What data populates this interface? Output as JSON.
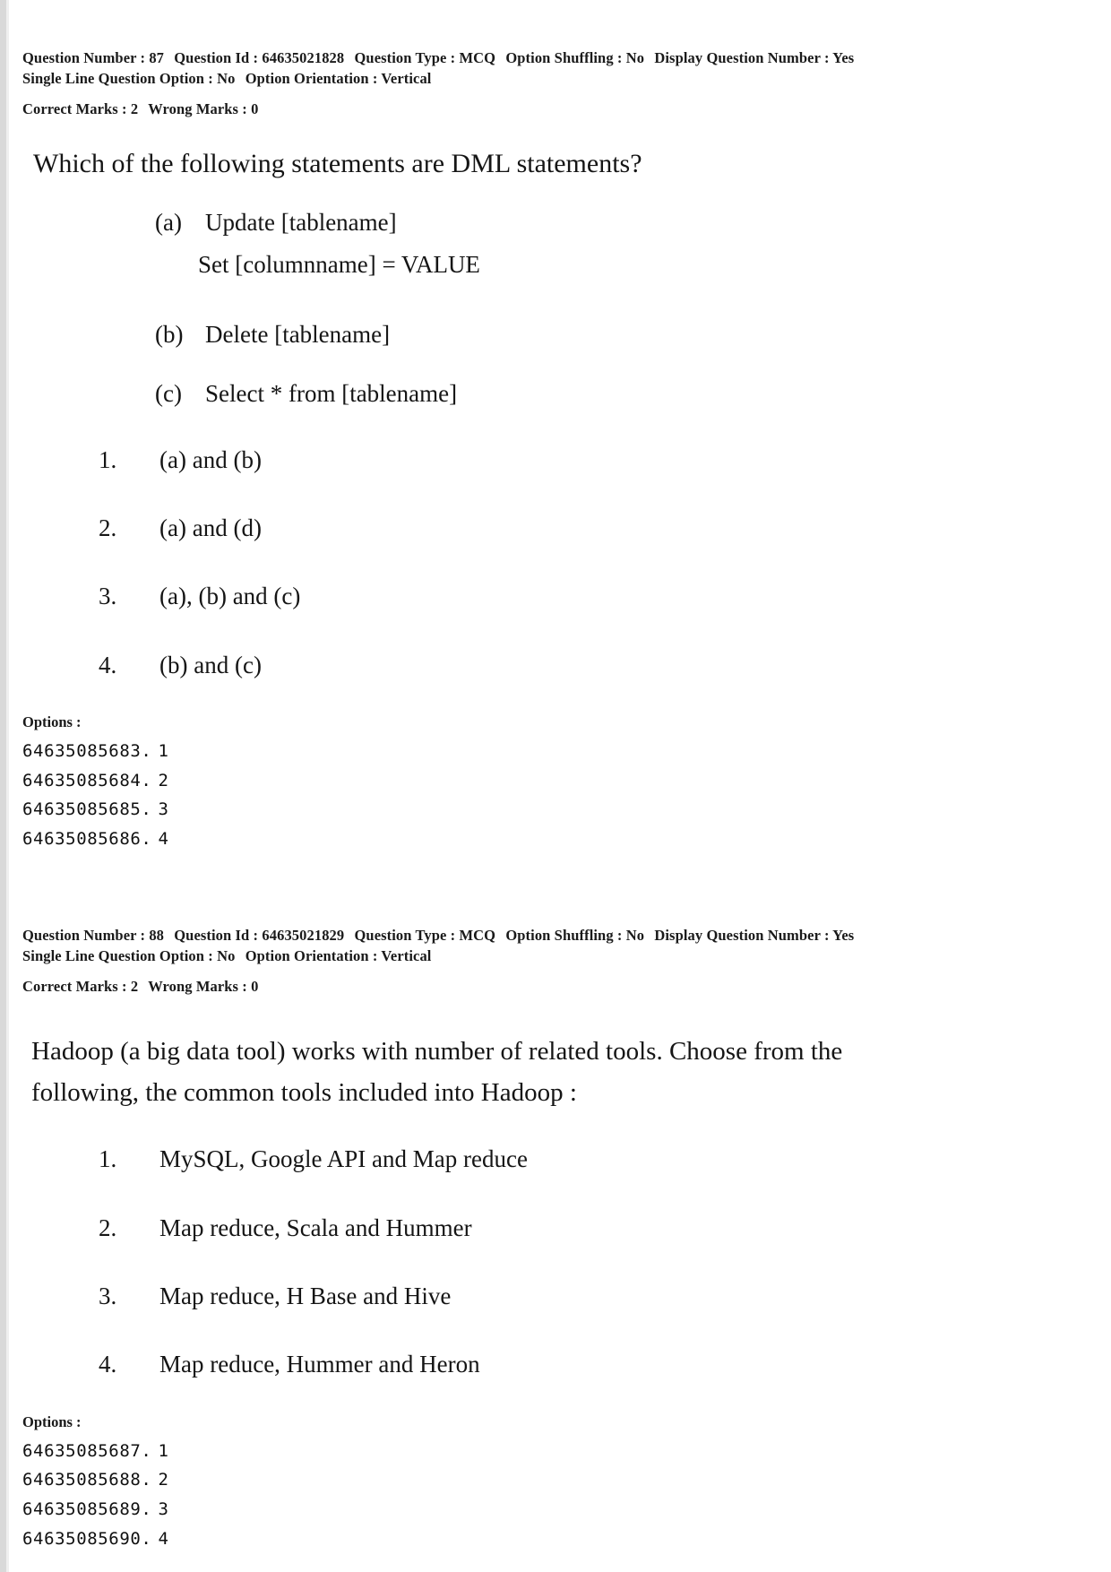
{
  "page": {
    "background_color": "#ffffff",
    "text_color": "#151515"
  },
  "questions": [
    {
      "meta": {
        "question_number_label": "Question Number :",
        "question_number_value": "87",
        "question_id_label": "Question Id :",
        "question_id_value": "64635021828",
        "question_type_label": "Question Type :",
        "question_type_value": "MCQ",
        "option_shuffling_label": "Option Shuffling :",
        "option_shuffling_value": "No",
        "display_question_number_label": "Display Question Number :",
        "display_question_number_value": "Yes",
        "single_line_option_label": "Single Line Question Option :",
        "single_line_option_value": "No",
        "option_orientation_label": "Option Orientation :",
        "option_orientation_value": "Vertical",
        "correct_marks_label": "Correct Marks :",
        "correct_marks_value": "2",
        "wrong_marks_label": "Wrong Marks :",
        "wrong_marks_value": "0"
      },
      "stem": "Which of the following statements are DML statements?",
      "substatements": [
        {
          "label": "(a)",
          "text": "Update [tablename]",
          "continuation": "Set [columnname] = VALUE"
        },
        {
          "label": "(b)",
          "text": "Delete [tablename]",
          "continuation": ""
        },
        {
          "label": "(c)",
          "text": "Select * from [tablename]",
          "continuation": ""
        }
      ],
      "choices": [
        {
          "number": "1.",
          "text": "(a) and (b)"
        },
        {
          "number": "2.",
          "text": "(a) and (d)"
        },
        {
          "number": "3.",
          "text": "(a), (b) and (c)"
        },
        {
          "number": "4.",
          "text": "(b) and (c)"
        }
      ],
      "options_heading": "Options :",
      "option_ids": [
        {
          "id": "64635085683.",
          "index": "1"
        },
        {
          "id": "64635085684.",
          "index": "2"
        },
        {
          "id": "64635085685.",
          "index": "3"
        },
        {
          "id": "64635085686.",
          "index": "4"
        }
      ]
    },
    {
      "meta": {
        "question_number_label": "Question Number :",
        "question_number_value": "88",
        "question_id_label": "Question Id :",
        "question_id_value": "64635021829",
        "question_type_label": "Question Type :",
        "question_type_value": "MCQ",
        "option_shuffling_label": "Option Shuffling :",
        "option_shuffling_value": "No",
        "display_question_number_label": "Display Question Number :",
        "display_question_number_value": "Yes",
        "single_line_option_label": "Single Line Question Option :",
        "single_line_option_value": "No",
        "option_orientation_label": "Option Orientation :",
        "option_orientation_value": "Vertical",
        "correct_marks_label": "Correct Marks :",
        "correct_marks_value": "2",
        "wrong_marks_label": "Wrong Marks :",
        "wrong_marks_value": "0"
      },
      "stem_line1": "Hadoop (a big data tool) works with number of related tools. Choose from the",
      "stem_line2": "following, the common tools included into Hadoop :",
      "choices": [
        {
          "number": "1.",
          "text": "MySQL, Google API and Map reduce"
        },
        {
          "number": "2.",
          "text": "Map reduce, Scala and Hummer"
        },
        {
          "number": "3.",
          "text": "Map reduce, H Base and Hive"
        },
        {
          "number": "4.",
          "text": "Map reduce, Hummer and Heron"
        }
      ],
      "options_heading": "Options :",
      "option_ids": [
        {
          "id": "64635085687.",
          "index": "1"
        },
        {
          "id": "64635085688.",
          "index": "2"
        },
        {
          "id": "64635085689.",
          "index": "3"
        },
        {
          "id": "64635085690.",
          "index": "4"
        }
      ]
    }
  ]
}
